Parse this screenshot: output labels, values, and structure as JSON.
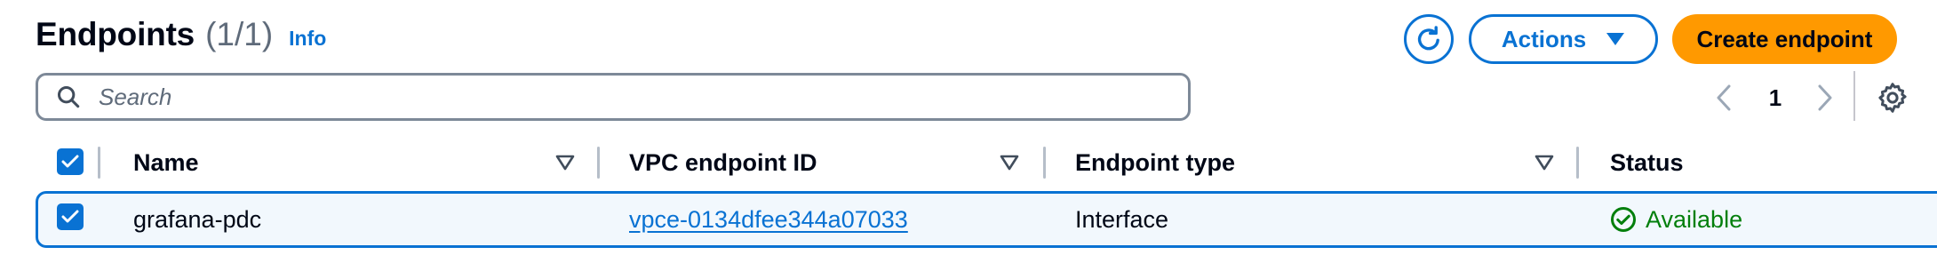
{
  "header": {
    "title": "Endpoints",
    "counter": "(1/1)",
    "info_link": "Info"
  },
  "toolbar": {
    "refresh_icon": "refresh-icon",
    "actions_label": "Actions",
    "create_label": "Create endpoint"
  },
  "search": {
    "placeholder": "Search",
    "value": ""
  },
  "pagination": {
    "current_page": "1"
  },
  "table": {
    "columns": [
      "Name",
      "VPC endpoint ID",
      "Endpoint type",
      "Status"
    ],
    "rows": [
      {
        "selected": true,
        "name": "grafana-pdc",
        "vpc_endpoint_id": "vpce-0134dfee344a07033",
        "endpoint_type": "Interface",
        "status": "Available"
      }
    ]
  },
  "colors": {
    "accent": "#0972d3",
    "primary_button": "#ff9900",
    "success": "#037f0c",
    "selected_row_bg": "#f2f8fd"
  }
}
